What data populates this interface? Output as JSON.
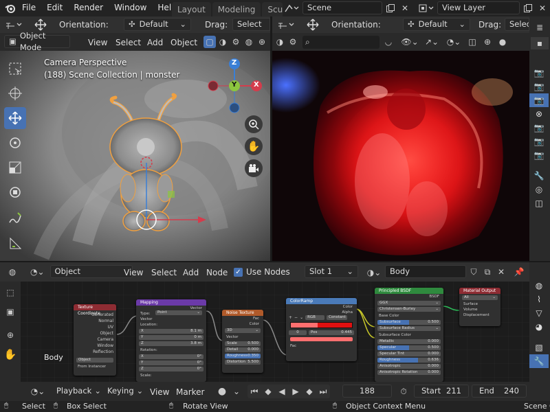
{
  "menu": [
    "File",
    "Edit",
    "Render",
    "Window",
    "Help"
  ],
  "workspaces": [
    "Layout",
    "Modeling",
    "Scu"
  ],
  "scene": {
    "label": "Scene",
    "view_layer": "View Layer"
  },
  "left_header": {
    "orientation_label": "Orientation:",
    "orientation_value": "Default",
    "drag_label": "Drag:",
    "drag_value": "Select Bo"
  },
  "right_header": {
    "orientation_label": "Orientation:",
    "orientation_value": "Default",
    "drag_label": "Drag:",
    "drag_value": "Selec"
  },
  "viewport_menu": {
    "mode": "Object Mode",
    "items": [
      "View",
      "Select",
      "Add",
      "Object"
    ]
  },
  "viewport": {
    "camera_label": "Camera Perspective",
    "collection_label": "(188) Scene Collection | monster"
  },
  "gizmo": {
    "z": "Z",
    "y": "Y",
    "x": "X"
  },
  "node_header": {
    "type": "Object",
    "items": [
      "View",
      "Select",
      "Add",
      "Node"
    ],
    "use_nodes": "Use Nodes",
    "slot": "Slot 1",
    "material": "Body"
  },
  "node_editor": {
    "object_label": "Body"
  },
  "nodes": {
    "texcoord": {
      "title": "Texture Coordinate",
      "outputs": [
        "Generated",
        "Normal",
        "UV",
        "Object",
        "Camera",
        "Window",
        "Reflection"
      ],
      "object_label": "Object",
      "instancer": "From Instancer"
    },
    "mapping": {
      "title": "Mapping",
      "output": "Vector",
      "type_label": "Type:",
      "type_value": "Point",
      "vector": "Vector",
      "location": "Location:",
      "loc": [
        [
          "X",
          "8.1 m"
        ],
        [
          "Y",
          "0 m"
        ],
        [
          "Z",
          "3.8 m"
        ]
      ],
      "rotation": "Rotation:",
      "rot": [
        [
          "X",
          "0°"
        ],
        [
          "Y",
          "0°"
        ],
        [
          "Z",
          "0°"
        ]
      ],
      "scale": "Scale:"
    },
    "noise": {
      "title": "Noise Texture",
      "outputs": [
        "Fac",
        "Color"
      ],
      "dim": "3D",
      "inputs": [
        [
          "Vector",
          ""
        ],
        [
          "Scale",
          "0.500"
        ],
        [
          "Detail",
          "0.000"
        ],
        [
          "Roughness",
          "0.350"
        ],
        [
          "Distortion",
          "5.500"
        ]
      ]
    },
    "ramp": {
      "title": "ColorRamp",
      "outputs": [
        "Color",
        "Alpha"
      ],
      "mode": "RGB",
      "interp": "Constant",
      "pos_index": "0",
      "pos_label": "Pos",
      "pos_value": "0.445",
      "input": "Fac"
    },
    "bsdf": {
      "title": "Principled BSDF",
      "output": "BSDF",
      "dist": "GGX",
      "sss": "Christensen-Burley",
      "rows": [
        [
          "Base Color",
          ""
        ],
        [
          "Subsurface",
          "0.500"
        ],
        [
          "Subsurface Radius",
          ""
        ],
        [
          "Subsurface Color",
          ""
        ],
        [
          "Metallic",
          "0.000"
        ],
        [
          "Specular",
          "0.500"
        ],
        [
          "Specular Tint",
          "0.000"
        ],
        [
          "Roughness",
          "0.636"
        ],
        [
          "Anisotropic",
          "0.000"
        ],
        [
          "Anisotropic Rotation",
          "0.000"
        ]
      ]
    },
    "output": {
      "title": "Material Output",
      "target": "All",
      "inputs": [
        "Surface",
        "Volume",
        "Displacement"
      ]
    }
  },
  "timeline": {
    "playback": "Playback",
    "keying": "Keying",
    "view": "View",
    "marker": "Marker",
    "frame": "188",
    "start_label": "Start",
    "start": "211",
    "end_label": "End",
    "end": "240"
  },
  "statusbar": {
    "select": "Select",
    "box_select": "Box Select",
    "rotate_view": "Rotate View",
    "context_menu": "Object Context Menu",
    "scene": "Scene C"
  },
  "colors": {
    "accent": "#4772b3",
    "selected_orange": "#f0a040",
    "x_axis": "#d43c4c",
    "y_axis": "#8cc63f",
    "z_axis": "#3a7fd6"
  }
}
